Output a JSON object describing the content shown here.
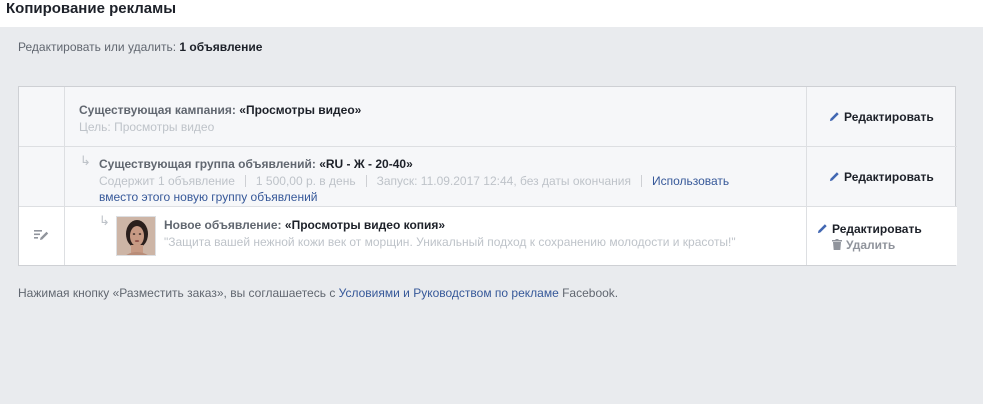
{
  "header": {
    "title": "Копирование рекламы"
  },
  "summary": {
    "prefix": "Редактировать или удалить:",
    "count": "1 объявление"
  },
  "campaign": {
    "label": "Существующая кампания:",
    "name": "«Просмотры видео»",
    "objective": "Цель: Просмотры видео",
    "edit_label": "Редактировать"
  },
  "ad_set": {
    "label": "Существующая группа объявлений:",
    "name": "«RU - Ж - 20-40»",
    "contains": "Содержит 1 объявление",
    "budget": "1 500,00 р. в день",
    "schedule": "Запуск: 11.09.2017 12:44, без даты окончания",
    "use_new_link_part1": "Использовать",
    "use_new_link_part2": "вместо этого новую группу объявлений",
    "edit_label": "Редактировать"
  },
  "ad": {
    "label": "Новое объявление:",
    "name": "«Просмотры видео копия»",
    "text": "\"Защита вашей нежной кожи век от морщин. Уникальный подход к сохранению молодости и красоты!\"",
    "edit_label": "Редактировать",
    "delete_label": "Удалить"
  },
  "footer": {
    "prefix": "Нажимая кнопку «Разместить заказ», вы соглашаетесь с",
    "link": "Условиями и Руководством по рекламе",
    "suffix": "Facebook."
  },
  "icons": {
    "edit": "pencil-icon",
    "delete": "trash-icon",
    "row_edit": "edit-note-icon",
    "child": "child-arrow-icon"
  },
  "colors": {
    "link": "#365899",
    "panel_bg": "#e9ebee",
    "muted": "#bec3c9"
  }
}
